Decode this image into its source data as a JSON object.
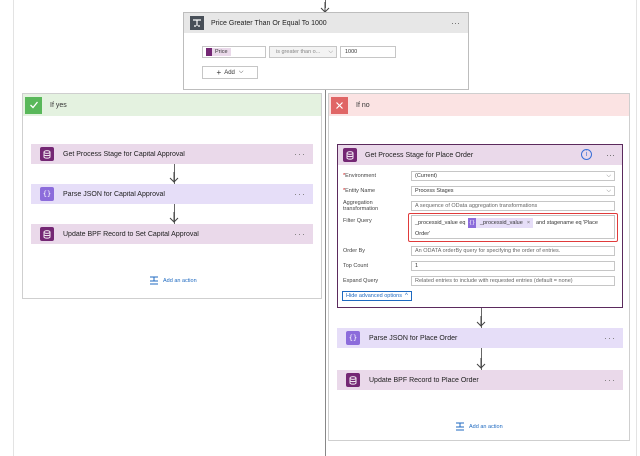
{
  "condition": {
    "title": "Price Greater Than Or Equal To 1000",
    "token_label": "Price",
    "operator": "is greater than o...",
    "value": "1000",
    "add_label": "Add"
  },
  "branch_yes": {
    "header": "If yes",
    "steps": [
      {
        "title": "Get Process Stage for Capital Approval"
      },
      {
        "title": "Parse JSON for Capital Approval"
      },
      {
        "title": "Update BPF Record to Set Capital Approval"
      }
    ],
    "add_action": "Add an action"
  },
  "branch_no": {
    "header": "If no",
    "expanded_step": {
      "title": "Get Process Stage for Place Order",
      "environment_label": "Environment",
      "environment_value": "(Current)",
      "entity_label": "Entity Name",
      "entity_value": "Process Stages",
      "aggregation_label_1": "Aggregation",
      "aggregation_label_2": "transformation",
      "aggregation_placeholder": "A sequence of OData aggregation transformations",
      "filter_label": "Filter Query",
      "filter_prefix": "_processid_value eq",
      "filter_token": "_processid_value",
      "filter_suffix": "and stagename eq 'Place",
      "filter_line2": "Order'",
      "orderby_label": "Order By",
      "orderby_placeholder": "An ODATA orderBy query for specifying the order of entries.",
      "topcount_label": "Top Count",
      "topcount_value": "1",
      "expand_label": "Expand Query",
      "expand_placeholder": "Related entries to include with requested entries (default = none)",
      "hide_advanced": "Hide advanced options"
    },
    "steps": [
      {
        "title": "Parse JSON for Place Order"
      },
      {
        "title": "Update BPF Record to Place Order"
      }
    ],
    "add_action": "Add an action"
  }
}
